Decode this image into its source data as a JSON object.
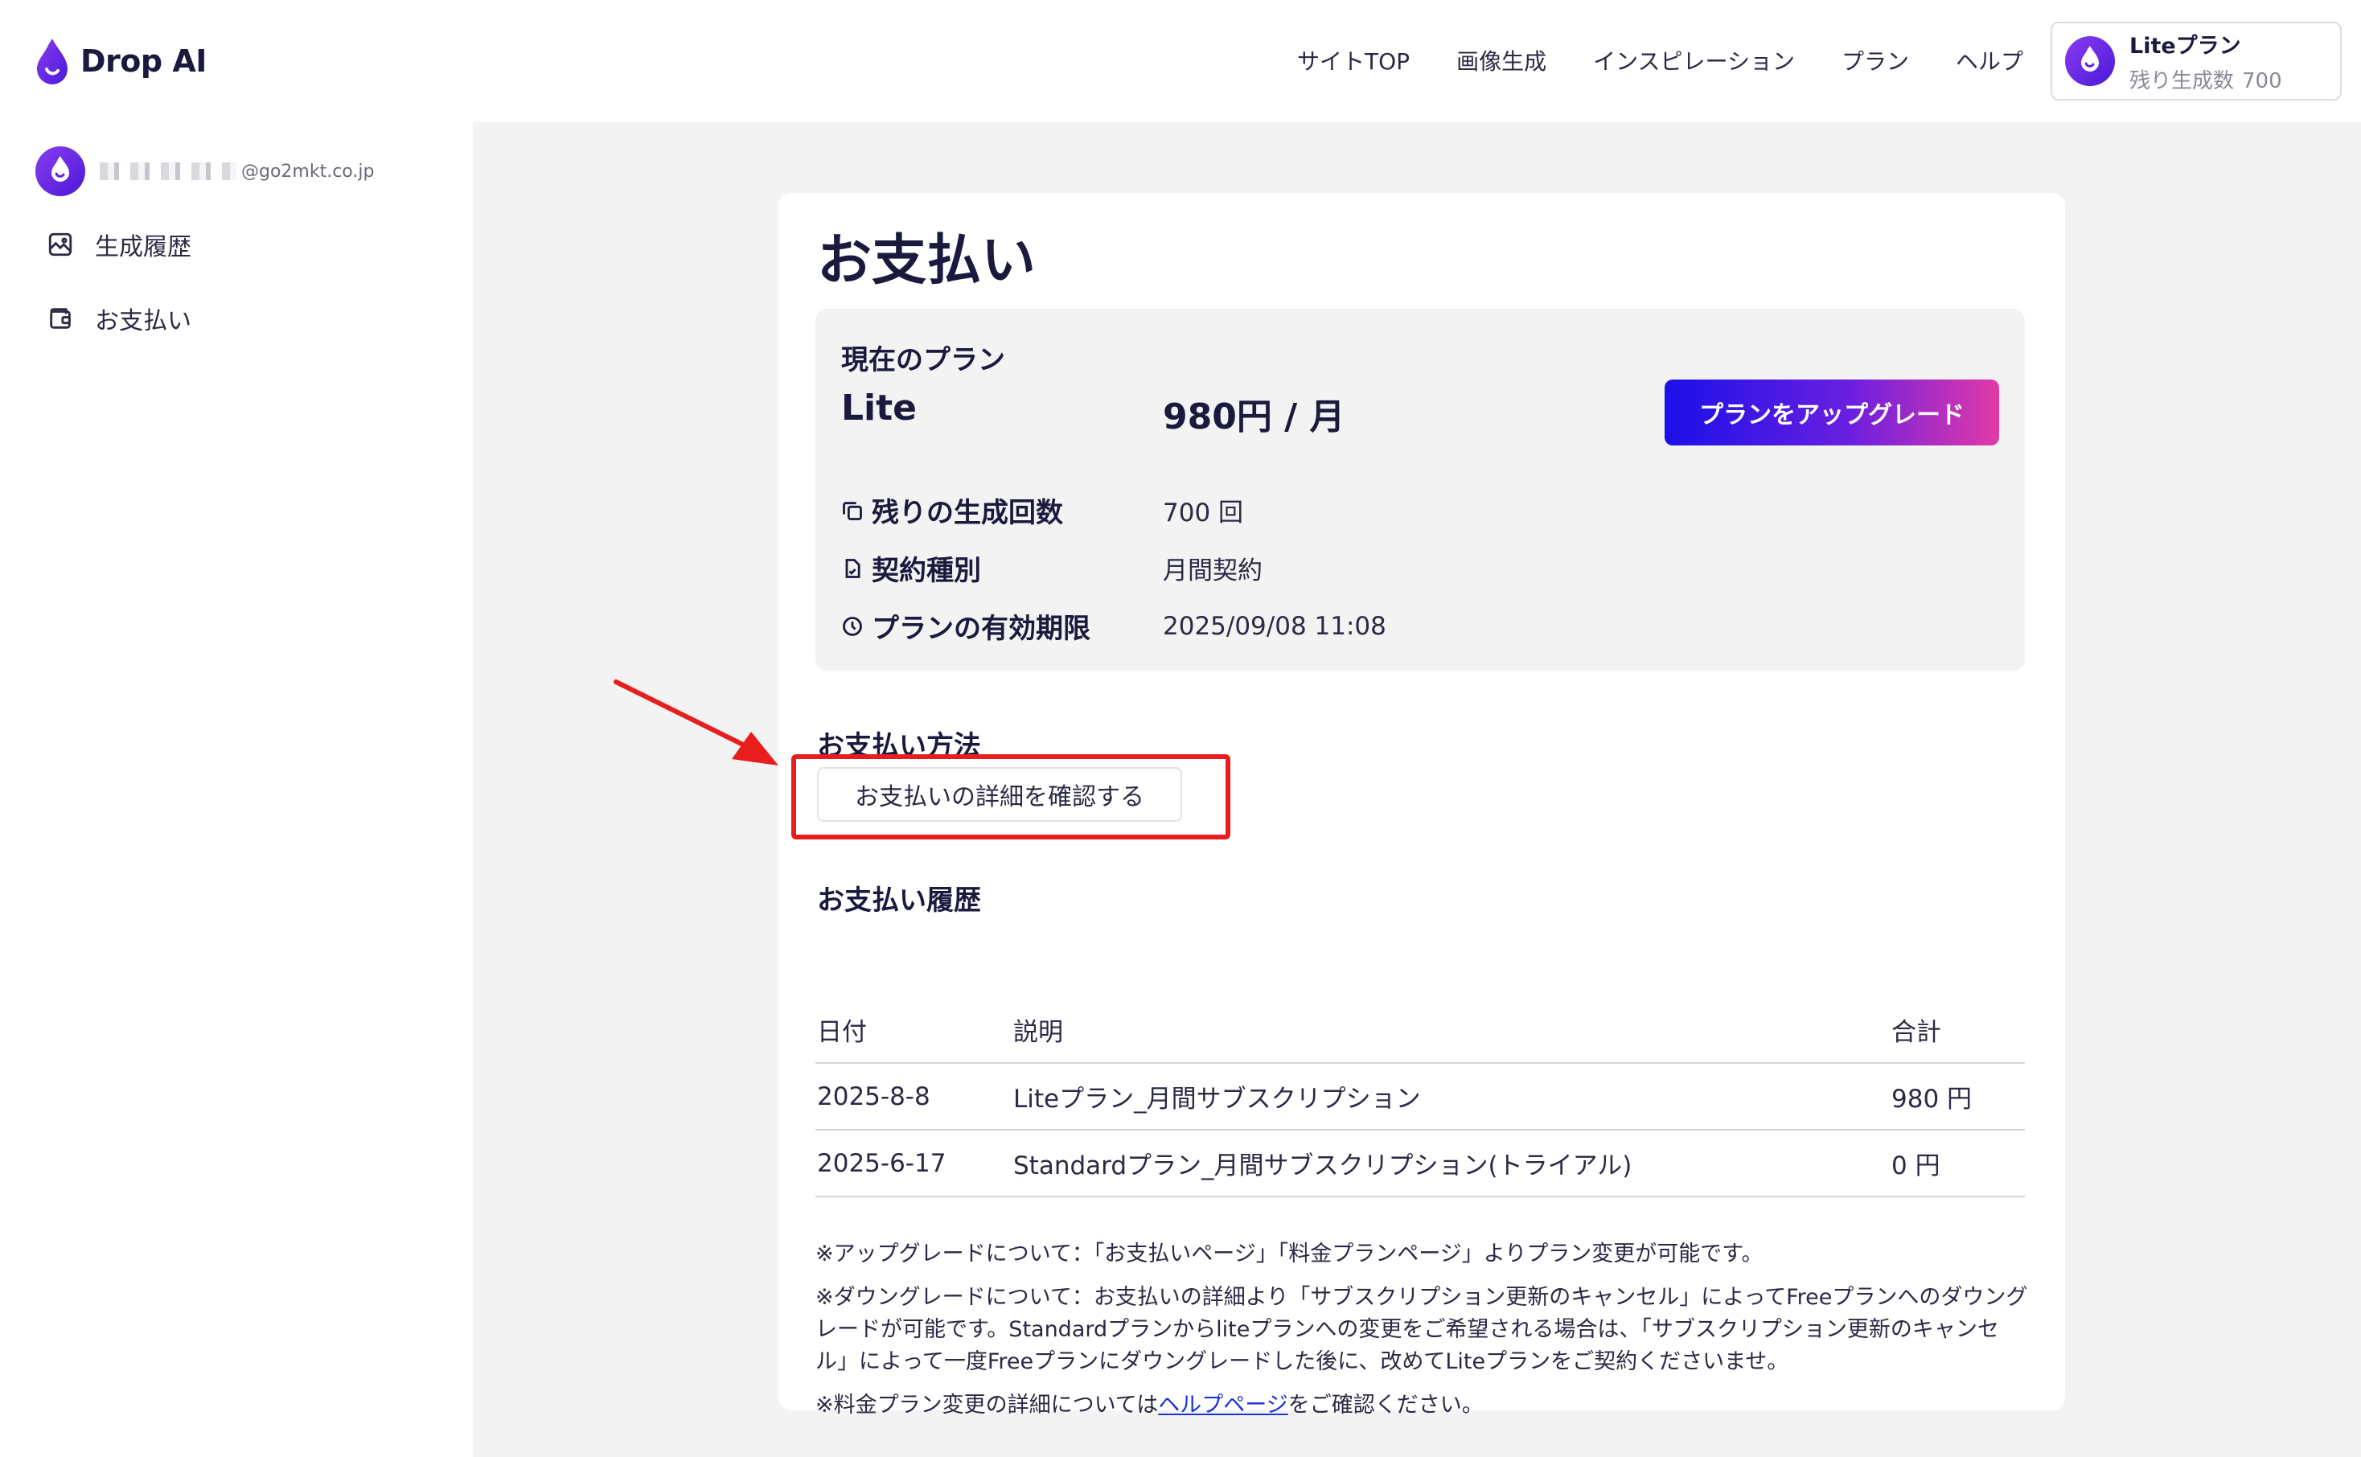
{
  "header": {
    "logo_text": "Drop AI",
    "nav": [
      "サイトTOP",
      "画像生成",
      "インスピレーション",
      "プラン",
      "ヘルプ"
    ],
    "plan_box": {
      "title": "Liteプラン",
      "remaining_label": "残り生成数",
      "remaining_value": "700"
    }
  },
  "sidebar": {
    "user_email_domain": "@go2mkt.co.jp",
    "items": [
      {
        "label": "生成履歴",
        "icon": "image-icon"
      },
      {
        "label": "お支払い",
        "icon": "wallet-icon"
      }
    ]
  },
  "main": {
    "title": "お支払い",
    "current_plan": {
      "label": "現在のプラン",
      "name": "Lite",
      "price": "980円 / 月",
      "upgrade_label": "プランをアップグレード",
      "rows": [
        {
          "key": "残りの生成回数",
          "value": "700 回",
          "icon": "copy-icon"
        },
        {
          "key": "契約種別",
          "value": "月間契約",
          "icon": "document-icon"
        },
        {
          "key": "プランの有効期限",
          "value": "2025/09/08 11:08",
          "icon": "clock-icon"
        }
      ]
    },
    "payment_method": {
      "title": "お支払い方法",
      "detail_button": "お支払いの詳細を確認する"
    },
    "history": {
      "title": "お支払い履歴",
      "columns": [
        "日付",
        "説明",
        "合計"
      ],
      "rows": [
        [
          "2025-8-8",
          "Liteプラン_月間サブスクリプション",
          "980 円"
        ],
        [
          "2025-6-17",
          "Standardプラン_月間サブスクリプション(トライアル)",
          "0 円"
        ]
      ]
    },
    "notes": {
      "note1": "※アップグレードについて：「お支払いページ」「料金プランページ」よりプラン変更が可能です。",
      "note2": "※ダウングレードについて：お支払いの詳細より「サブスクリプション更新のキャンセル」によってFreeプランへのダウングレードが可能です。Standardプランからliteプランへの変更をご希望される場合は、「サブスクリプション更新のキャンセル」によって一度Freeプランにダウングレードした後に、改めてLiteプランをご契約くださいませ。",
      "note3_prefix": "※料金プラン変更の詳細については",
      "note3_link": "ヘルプページ",
      "note3_suffix": "をご確認ください。"
    }
  },
  "colors": {
    "brand_purple": "#6a1fe0",
    "gradient_start": "#1a10e8",
    "gradient_end": "#e23aa6",
    "annotation_red": "#e81e1e",
    "link_blue": "#1a33d8"
  }
}
